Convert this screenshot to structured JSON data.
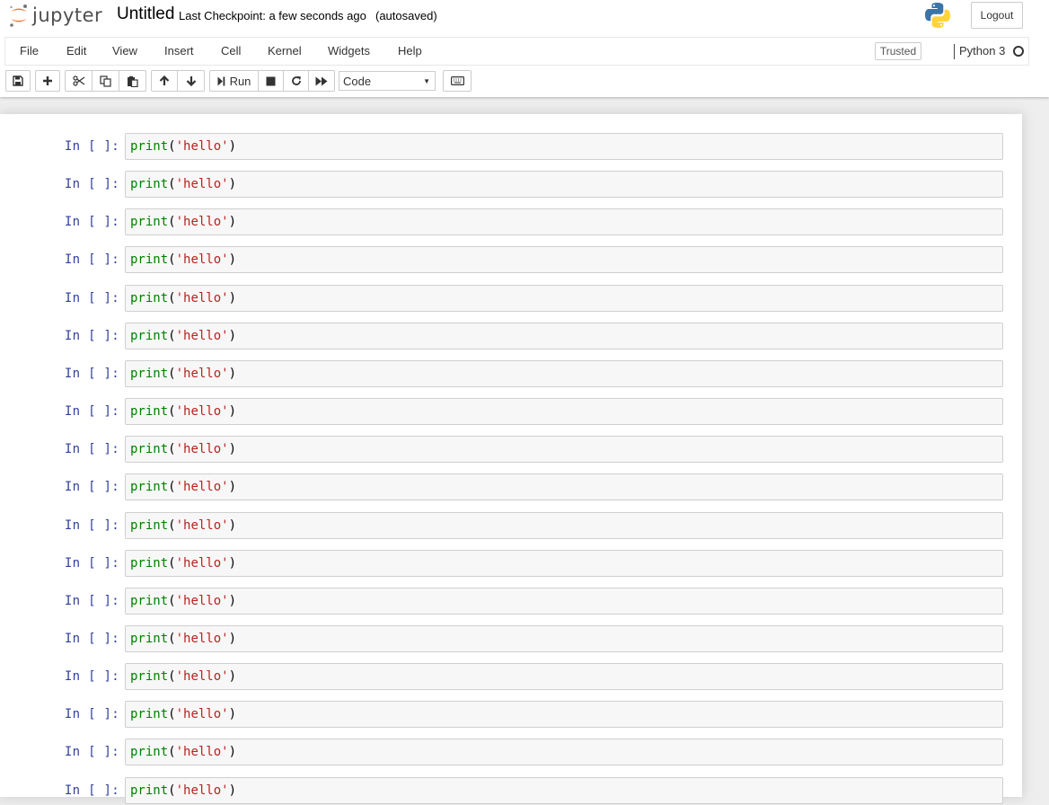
{
  "header": {
    "logo_text": "jupyter",
    "notebook_name": "Untitled",
    "checkpoint": "Last Checkpoint: a few seconds ago",
    "autosave": "(autosaved)",
    "logout_label": "Logout"
  },
  "menu": {
    "items": [
      "File",
      "Edit",
      "View",
      "Insert",
      "Cell",
      "Kernel",
      "Widgets",
      "Help"
    ],
    "trusted_label": "Trusted",
    "kernel_name": "Python 3"
  },
  "toolbar": {
    "buttons": [
      "save-icon",
      "plus-icon",
      "scissors-icon",
      "copy-icon",
      "paste-icon",
      "arrow-up-icon",
      "arrow-down-icon",
      "run-icon",
      "stop-icon",
      "restart-icon",
      "fast-forward-icon",
      "keyboard-icon"
    ],
    "run_label": "Run",
    "cell_type": "Code"
  },
  "colors": {
    "prompt": "#303f9f",
    "builtin": "#008000",
    "string": "#ba2121",
    "logo_orange": "#f37726"
  },
  "cells": [
    {
      "prompt": "In [ ]:",
      "fn": "print",
      "open": "(",
      "arg": "'hello'",
      "close": ")"
    },
    {
      "prompt": "In [ ]:",
      "fn": "print",
      "open": "(",
      "arg": "'hello'",
      "close": ")"
    },
    {
      "prompt": "In [ ]:",
      "fn": "print",
      "open": "(",
      "arg": "'hello'",
      "close": ")"
    },
    {
      "prompt": "In [ ]:",
      "fn": "print",
      "open": "(",
      "arg": "'hello'",
      "close": ")"
    },
    {
      "prompt": "In [ ]:",
      "fn": "print",
      "open": "(",
      "arg": "'hello'",
      "close": ")"
    },
    {
      "prompt": "In [ ]:",
      "fn": "print",
      "open": "(",
      "arg": "'hello'",
      "close": ")"
    },
    {
      "prompt": "In [ ]:",
      "fn": "print",
      "open": "(",
      "arg": "'hello'",
      "close": ")"
    },
    {
      "prompt": "In [ ]:",
      "fn": "print",
      "open": "(",
      "arg": "'hello'",
      "close": ")"
    },
    {
      "prompt": "In [ ]:",
      "fn": "print",
      "open": "(",
      "arg": "'hello'",
      "close": ")"
    },
    {
      "prompt": "In [ ]:",
      "fn": "print",
      "open": "(",
      "arg": "'hello'",
      "close": ")"
    },
    {
      "prompt": "In [ ]:",
      "fn": "print",
      "open": "(",
      "arg": "'hello'",
      "close": ")"
    },
    {
      "prompt": "In [ ]:",
      "fn": "print",
      "open": "(",
      "arg": "'hello'",
      "close": ")"
    },
    {
      "prompt": "In [ ]:",
      "fn": "print",
      "open": "(",
      "arg": "'hello'",
      "close": ")"
    },
    {
      "prompt": "In [ ]:",
      "fn": "print",
      "open": "(",
      "arg": "'hello'",
      "close": ")"
    },
    {
      "prompt": "In [ ]:",
      "fn": "print",
      "open": "(",
      "arg": "'hello'",
      "close": ")"
    },
    {
      "prompt": "In [ ]:",
      "fn": "print",
      "open": "(",
      "arg": "'hello'",
      "close": ")"
    },
    {
      "prompt": "In [ ]:",
      "fn": "print",
      "open": "(",
      "arg": "'hello'",
      "close": ")"
    },
    {
      "prompt": "In [ ]:",
      "fn": "print",
      "open": "(",
      "arg": "'hello'",
      "close": ")"
    }
  ]
}
